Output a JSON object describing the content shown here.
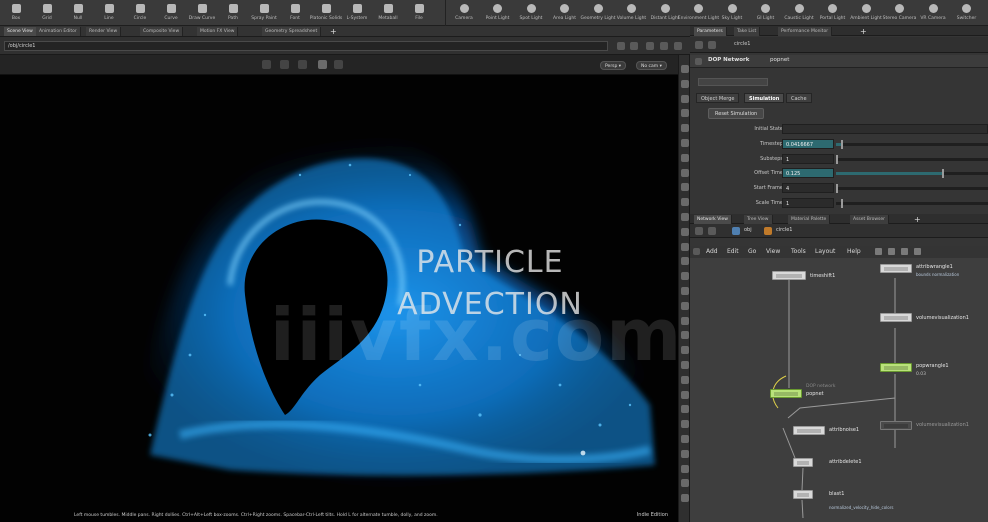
{
  "shelf_left": {
    "tools": [
      {
        "label": "Box",
        "icon": "box-icon"
      },
      {
        "label": "Grid",
        "icon": "grid-icon"
      },
      {
        "label": "Null",
        "icon": "null-icon"
      },
      {
        "label": "Line",
        "icon": "line-icon"
      },
      {
        "label": "Circle",
        "icon": "circle-icon"
      },
      {
        "label": "Curve",
        "icon": "curve-icon"
      },
      {
        "label": "Draw Curve",
        "icon": "draw-curve-icon"
      },
      {
        "label": "Path",
        "icon": "path-icon"
      },
      {
        "label": "Spray Paint",
        "icon": "spray-paint-icon"
      },
      {
        "label": "Font",
        "icon": "font-icon"
      },
      {
        "label": "Platonic Solids",
        "icon": "platonic-icon"
      },
      {
        "label": "L-System",
        "icon": "lsystem-icon"
      },
      {
        "label": "Metaball",
        "icon": "metaball-icon"
      },
      {
        "label": "File",
        "icon": "file-icon"
      }
    ]
  },
  "shelf_right": {
    "tools": [
      {
        "label": "Camera",
        "icon": "camera-icon"
      },
      {
        "label": "Point Light",
        "icon": "point-light-icon"
      },
      {
        "label": "Spot Light",
        "icon": "spot-light-icon"
      },
      {
        "label": "Area Light",
        "icon": "area-light-icon"
      },
      {
        "label": "Geometry Light",
        "icon": "geometry-light-icon"
      },
      {
        "label": "Volume Light",
        "icon": "volume-light-icon"
      },
      {
        "label": "Distant Light",
        "icon": "distant-light-icon"
      },
      {
        "label": "Environment Light",
        "icon": "environment-light-icon"
      },
      {
        "label": "Sky Light",
        "icon": "sky-light-icon"
      },
      {
        "label": "GI Light",
        "icon": "gi-light-icon"
      },
      {
        "label": "Caustic Light",
        "icon": "caustic-light-icon"
      },
      {
        "label": "Portal Light",
        "icon": "portal-light-icon"
      },
      {
        "label": "Ambient Light",
        "icon": "ambient-light-icon"
      },
      {
        "label": "Stereo Camera",
        "icon": "stereo-camera-icon"
      },
      {
        "label": "VR Camera",
        "icon": "vr-camera-icon"
      },
      {
        "label": "Switcher",
        "icon": "switcher-icon"
      }
    ]
  },
  "desktop_tabs": [
    "Scene View",
    "Animation Editor",
    "Render View",
    "Composite View",
    "Motion FX View",
    "Geometry Spreadsheet"
  ],
  "path_field": "/obj/circle1",
  "viewport": {
    "persp_label": "Persp ▾",
    "cam_label": "No cam ▾",
    "overlay_line1": "PARTICLE",
    "overlay_line2": "ADVECTION",
    "watermark": "iiivfx.com",
    "status_text": "Left mouse tumbles. Middle pans. Right dollies. Ctrl+Alt+Left box-zooms. Ctrl+Right zooms. Spacebar-Ctrl-Left tilts. Hold L for alternate tumble, dolly, and zoom.",
    "edition": "Indie Edition"
  },
  "parm_panel": {
    "tabs": [
      "Parameters",
      "Take List",
      "Performance Monitor"
    ],
    "path": "circle1",
    "node_type": "DOP Network",
    "node_name": "popnet",
    "sim_tabs": [
      "Object Merge",
      "Simulation",
      "Cache"
    ],
    "reset_button": "Reset Simulation",
    "initial_state_label": "Initial State",
    "params": [
      {
        "label": "Timestep",
        "value": "0.0416667",
        "teal": true
      },
      {
        "label": "Substeps",
        "value": "1",
        "teal": false
      },
      {
        "label": "Offset Time",
        "value": "0.125",
        "teal": true
      },
      {
        "label": "Start Frame",
        "value": "4",
        "teal": false
      },
      {
        "label": "Scale Time",
        "value": "1",
        "teal": false
      }
    ]
  },
  "network_panel": {
    "tabs": [
      "Network View",
      "Tree View",
      "Material Palette",
      "Asset Browser"
    ],
    "crumbs": [
      "obj",
      "circle1"
    ],
    "menu": [
      "Add",
      "Edit",
      "Go",
      "View",
      "Tools",
      "Layout",
      "Help"
    ],
    "nodes": {
      "timeshift": "timeshift1",
      "attribwrangle": "attribwrangle1",
      "attribwrangle_sub": "bounds normalization",
      "volumevisualization": "volumevisualization1",
      "popwrangle": "popwrangle1",
      "popwrangle_sub": "0.03",
      "popnet": "popnet",
      "popnet_sub": "DOP network",
      "volumevisualization_b": "volumevisualization1",
      "attribnoise": "attribnoise1",
      "attribdelete": "attribdelete1",
      "blast": "blast1",
      "blast_sub": "normalized_velocity_hide_colors"
    }
  }
}
